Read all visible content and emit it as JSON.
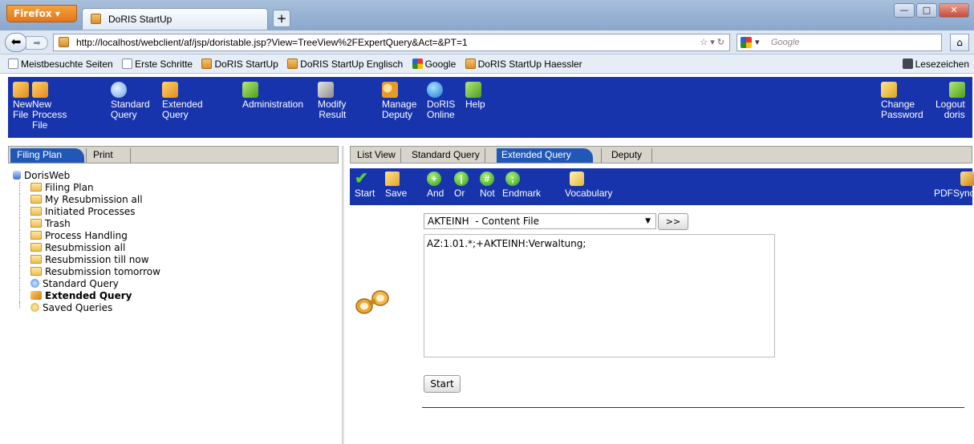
{
  "browser": {
    "menu_button": "Firefox",
    "tab_title": "DoRIS StartUp",
    "new_tab": "+",
    "url": "http://localhost/webclient/af/jsp/doristable.jsp?View=TreeView%2FExpertQuery&Act=&PT=1",
    "search_placeholder": "Google",
    "bookmarks": [
      "Meistbesuchte Seiten",
      "Erste Schritte",
      "DoRIS StartUp",
      "DoRIS StartUp Englisch",
      "Google",
      "DoRIS StartUp Haessler"
    ],
    "bookmarks_menu": "Lesezeichen"
  },
  "toolbar": {
    "new_file": "New\nFile",
    "new_process_file": "New\nProcess\nFile",
    "standard_query": "Standard\nQuery",
    "extended_query": "Extended\nQuery",
    "administration": "Administration",
    "modify_result": "Modify\nResult",
    "manage_deputy": "Manage\nDeputy",
    "doris_online": "DoRIS\nOnline",
    "help": "Help",
    "change_password": "Change\nPassword",
    "logout": "Logout\ndoris"
  },
  "left_panel": {
    "tabs": [
      "Filing Plan",
      "Print"
    ],
    "tree_root": "DorisWeb",
    "tree_items": [
      "Filing Plan",
      "My Resubmission all",
      "Initiated Processes",
      "Trash",
      "Process Handling",
      "Resubmission all",
      "Resubmission till now",
      "Resubmission tomorrow",
      "Standard Query",
      "Extended Query",
      "Saved Queries"
    ]
  },
  "right_panel": {
    "tabs": [
      "List View",
      "Standard Query",
      "Extended Query",
      "Deputy"
    ],
    "query_toolbar": {
      "start": "Start",
      "save": "Save",
      "and": "And",
      "or": "Or",
      "not": "Not",
      "endmark": "Endmark",
      "vocabulary": "Vocabulary",
      "pdfsync": "PDFSync"
    },
    "field_select": "AKTEINH  - Content File",
    "add_button": ">>",
    "query_text": "AZ:1.01.*;+AKTEINH:Verwaltung;",
    "start_button": "Start"
  }
}
